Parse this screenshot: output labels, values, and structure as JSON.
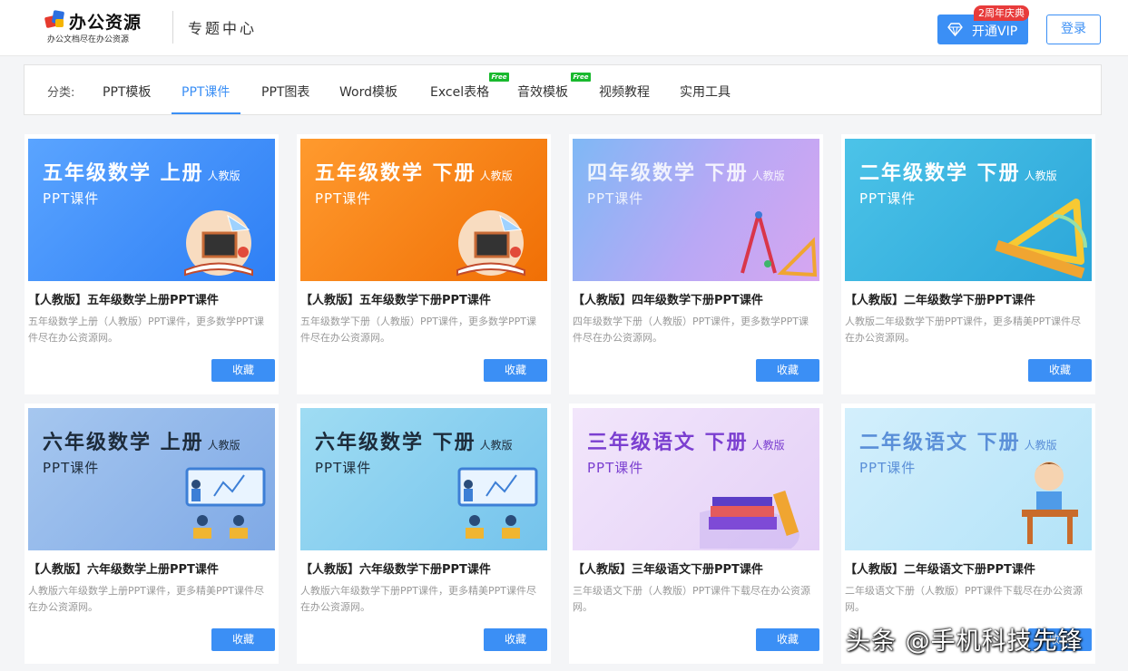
{
  "header": {
    "logo_title": "办公资源",
    "logo_sub": "办公文档尽在办公资源",
    "center_title": "专题中心",
    "vip_label": "开通VIP",
    "anniv_badge": "2周年庆典",
    "login_label": "登录"
  },
  "categories": {
    "prefix": "分类:",
    "items": [
      {
        "label": "PPT模板"
      },
      {
        "label": "PPT课件",
        "active": true
      },
      {
        "label": "PPT图表"
      },
      {
        "label": "Word模板"
      },
      {
        "label": "Excel表格",
        "badge": "Free"
      },
      {
        "label": "音效模板",
        "badge": "Free"
      },
      {
        "label": "视频教程"
      },
      {
        "label": "实用工具"
      }
    ]
  },
  "cards": [
    {
      "thumb_title": "五年级数学 上册",
      "thumb_edition": "人教版",
      "thumb_sub": "PPT课件",
      "title": "【人教版】五年级数学上册PPT课件",
      "desc": "五年级数学上册（人教版）PPT课件，更多数学PPT课件尽在办公资源网。",
      "button": "收藏"
    },
    {
      "thumb_title": "五年级数学 下册",
      "thumb_edition": "人教版",
      "thumb_sub": "PPT课件",
      "title": "【人教版】五年级数学下册PPT课件",
      "desc": "五年级数学下册（人教版）PPT课件，更多数学PPT课件尽在办公资源网。",
      "button": "收藏"
    },
    {
      "thumb_title": "四年级数学 下册",
      "thumb_edition": "人教版",
      "thumb_sub": "PPT课件",
      "title": "【人教版】四年级数学下册PPT课件",
      "desc": "四年级数学下册（人教版）PPT课件，更多数学PPT课件尽在办公资源网。",
      "button": "收藏"
    },
    {
      "thumb_title": "二年级数学 下册",
      "thumb_edition": "人教版",
      "thumb_sub": "PPT课件",
      "title": "【人教版】二年级数学下册PPT课件",
      "desc": "人教版二年级数学下册PPT课件，更多精美PPT课件尽在办公资源网。",
      "button": "收藏"
    },
    {
      "thumb_title": "六年级数学 上册",
      "thumb_edition": "人教版",
      "thumb_sub": "PPT课件",
      "title": "【人教版】六年级数学上册PPT课件",
      "desc": "人教版六年级数学上册PPT课件，更多精美PPT课件尽在办公资源网。",
      "button": "收藏"
    },
    {
      "thumb_title": "六年级数学 下册",
      "thumb_edition": "人教版",
      "thumb_sub": "PPT课件",
      "title": "【人教版】六年级数学下册PPT课件",
      "desc": "人教版六年级数学下册PPT课件，更多精美PPT课件尽在办公资源网。",
      "button": "收藏"
    },
    {
      "thumb_title": "三年级语文 下册",
      "thumb_edition": "人教版",
      "thumb_sub": "PPT课件",
      "title": "【人教版】三年级语文下册PPT课件",
      "desc": "三年级语文下册（人教版）PPT课件下载尽在办公资源网。",
      "button": "收藏"
    },
    {
      "thumb_title": "二年级语文 下册",
      "thumb_edition": "人教版",
      "thumb_sub": "PPT课件",
      "title": "【人教版】二年级语文下册PPT课件",
      "desc": "二年级语文下册（人教版）PPT课件下载尽在办公资源网。",
      "button": "收藏"
    }
  ],
  "watermark": "头条 @手机科技先锋",
  "colors": {
    "accent": "#3b8ff5",
    "badge_red": "#e83b3b",
    "free_green": "#19b92e"
  }
}
